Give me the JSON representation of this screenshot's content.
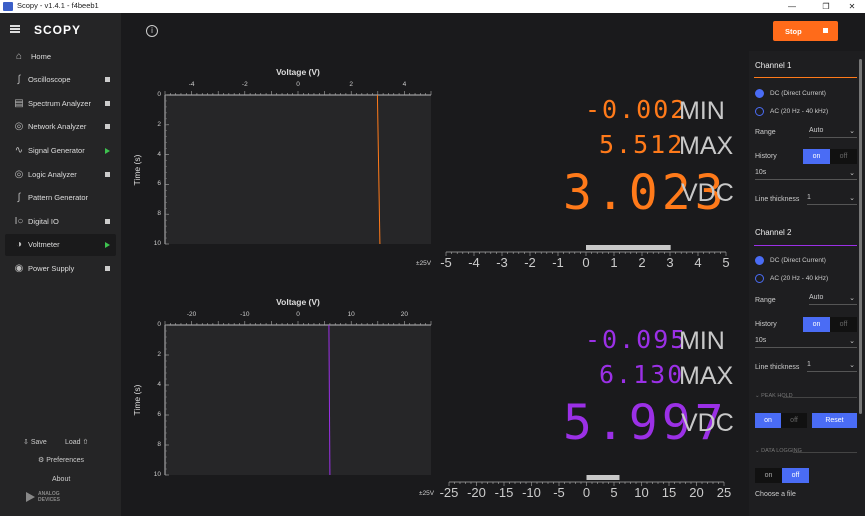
{
  "window": {
    "title": "Scopy - v1.4.1 - f4beeb1"
  },
  "brand": {
    "logo_text": "SCOPY",
    "company_line1": "ANALOG",
    "company_line2": "DEVICES"
  },
  "sidebar": {
    "home": "Home",
    "items": [
      {
        "label": "Oscilloscope",
        "state": "stopped",
        "icon": "wave-icon"
      },
      {
        "label": "Spectrum Analyzer",
        "state": "stopped",
        "icon": "spectrum-icon"
      },
      {
        "label": "Network Analyzer",
        "state": "stopped",
        "icon": "network-icon"
      },
      {
        "label": "Signal Generator",
        "state": "running",
        "icon": "signal-icon"
      },
      {
        "label": "Logic Analyzer",
        "state": "stopped",
        "icon": "logic-icon"
      },
      {
        "label": "Pattern Generator",
        "state": "none",
        "icon": "pattern-icon"
      },
      {
        "label": "Digital IO",
        "state": "stopped",
        "icon": "digital-io-icon"
      },
      {
        "label": "Voltmeter",
        "state": "running",
        "icon": "voltmeter-icon"
      },
      {
        "label": "Power Supply",
        "state": "stopped",
        "icon": "power-icon"
      }
    ],
    "save": "Save",
    "load": "Load",
    "preferences": "Preferences",
    "about": "About"
  },
  "toolbar": {
    "stop_label": "Stop"
  },
  "channels": [
    {
      "axis_title": "Voltage (V)",
      "y_title": "Time (s)",
      "x_ticks": [
        "-4",
        "-2",
        "0",
        "2",
        "4"
      ],
      "y_ticks": [
        "0",
        "2",
        "4",
        "6",
        "8",
        "10"
      ],
      "min": "-0.002",
      "min_label": "MIN",
      "max": "5.512",
      "max_label": "MAX",
      "value": "3.023",
      "unit": "VDC",
      "bar_range": "±25V",
      "bar_ticks": [
        "-5",
        "-4",
        "-3",
        "-2",
        "-1",
        "0",
        "1",
        "2",
        "3",
        "4",
        "5"
      ],
      "trace_value": 3.023,
      "bar_fill": 3.023,
      "color": "#ff7a1a"
    },
    {
      "axis_title": "Voltage (V)",
      "y_title": "Time (s)",
      "x_ticks": [
        "-20",
        "-10",
        "0",
        "10",
        "20"
      ],
      "y_ticks": [
        "0",
        "2",
        "4",
        "6",
        "8",
        "10"
      ],
      "min": "-0.095",
      "min_label": "MIN",
      "max": "6.130",
      "max_label": "MAX",
      "value": "5.997",
      "unit": "VDC",
      "bar_range": "±25V",
      "bar_ticks": [
        "-25",
        "-20",
        "-15",
        "-10",
        "-5",
        "0",
        "5",
        "10",
        "15",
        "20",
        "25"
      ],
      "trace_value": 5.997,
      "bar_fill": 5.997,
      "color": "#9b30e6"
    }
  ],
  "settings": {
    "ch1": {
      "title": "Channel 1",
      "dc": "DC (Direct Current)",
      "ac": "AC (20 Hz - 40 kHz)",
      "range_label": "Range",
      "range_value": "Auto",
      "history_label": "History",
      "on": "on",
      "off": "off",
      "history_value": "10s",
      "thickness_label": "Line thickness",
      "thickness_value": "1"
    },
    "ch2": {
      "title": "Channel 2",
      "dc": "DC (Direct Current)",
      "ac": "AC (20 Hz - 40 kHz)",
      "range_label": "Range",
      "range_value": "Auto",
      "history_label": "History",
      "on": "on",
      "off": "off",
      "history_value": "10s",
      "thickness_label": "Line thickness",
      "thickness_value": "1"
    },
    "peak_hold": {
      "title": "PEAK HOLD",
      "on": "on",
      "off": "off",
      "reset": "Reset"
    },
    "data_logging": {
      "title": "DATA LOGGING",
      "on": "on",
      "off": "off",
      "choose_file": "Choose a file"
    }
  },
  "colors": {
    "accent": "#4a6cf5",
    "stop": "#ff6b1a",
    "ch1": "#ff7a1a",
    "ch2": "#9b30e6"
  }
}
